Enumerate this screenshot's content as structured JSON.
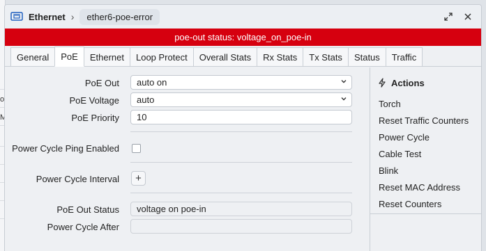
{
  "window": {
    "title": "Ethernet",
    "breadcrumb": "ether6-poe-error",
    "restore_icon": "restore-icon",
    "close_icon": "close-icon"
  },
  "banner": {
    "text": "poe-out status: voltage_on_poe-in",
    "color": "#d6000f"
  },
  "tabs": [
    {
      "label": "General"
    },
    {
      "label": "PoE",
      "active": true
    },
    {
      "label": "Ethernet"
    },
    {
      "label": "Loop Protect"
    },
    {
      "label": "Overall Stats"
    },
    {
      "label": "Rx Stats"
    },
    {
      "label": "Tx Stats"
    },
    {
      "label": "Status"
    },
    {
      "label": "Traffic"
    }
  ],
  "form": {
    "poe_out": {
      "label": "PoE Out",
      "value": "auto on"
    },
    "poe_voltage": {
      "label": "PoE Voltage",
      "value": "auto"
    },
    "poe_priority": {
      "label": "PoE Priority",
      "value": "10"
    },
    "power_cycle_ping": {
      "label": "Power Cycle Ping Enabled",
      "checked": false
    },
    "power_cycle_interval": {
      "label": "Power Cycle Interval",
      "button": "+"
    },
    "poe_out_status": {
      "label": "PoE Out Status",
      "value": "voltage on poe-in"
    },
    "power_cycle_after": {
      "label": "Power Cycle After",
      "value": ""
    }
  },
  "actions": {
    "title": "Actions",
    "items": [
      "Torch",
      "Reset Traffic Counters",
      "Power Cycle",
      "Cable Test",
      "Blink",
      "Reset MAC Address",
      "Reset Counters"
    ]
  },
  "background": {
    "fragments": [
      "o",
      "M"
    ]
  }
}
